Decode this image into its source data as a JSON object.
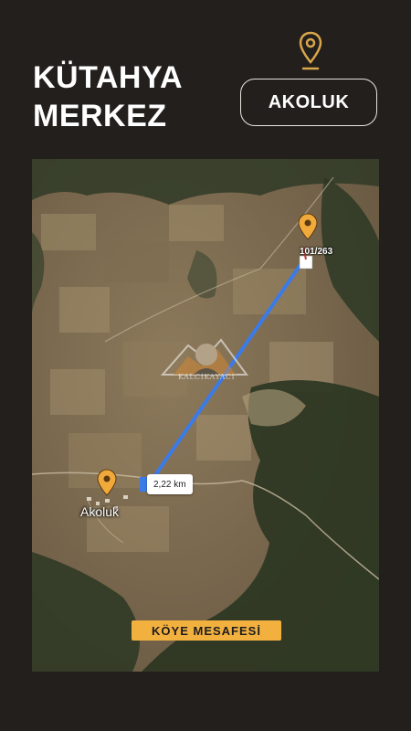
{
  "header": {
    "title_line1": "KÜTAHYA",
    "title_line2": "MERKEZ",
    "location_icon": "map-pin-icon",
    "village_button_label": "AKOLUK"
  },
  "map": {
    "parcel_label": "101/263",
    "village_label": "Akoluk",
    "distance_label": "2,22 km",
    "footer_label": "KÖYE MESAFESİ",
    "watermark_text": "KALCIKAYACI",
    "pin_color": "#f2a93b",
    "route_color": "#3b7be8"
  }
}
